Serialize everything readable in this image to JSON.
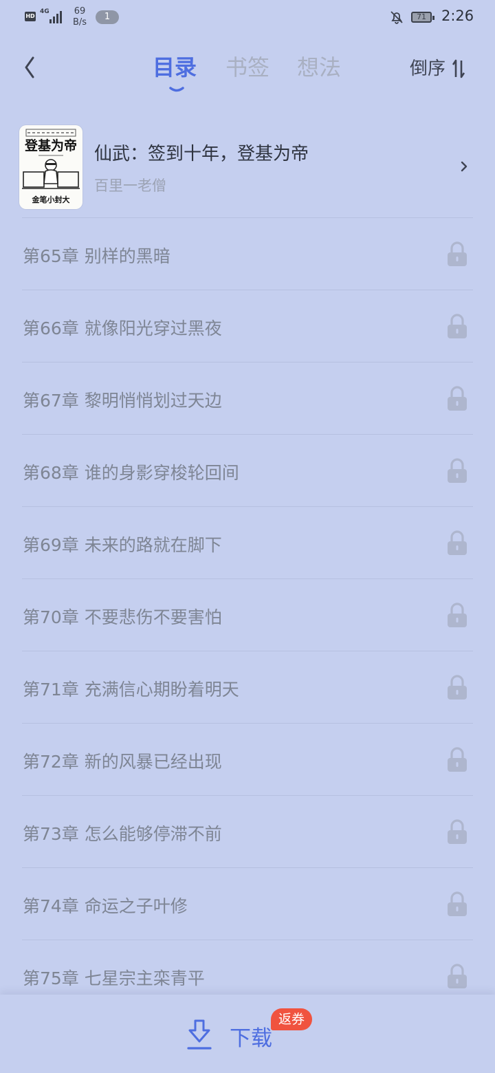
{
  "status_bar": {
    "hd": "HD",
    "network": "4G",
    "speed_value": "69",
    "speed_unit": "B/s",
    "notification_count": "1",
    "battery": "71",
    "time": "2:26"
  },
  "header": {
    "tabs": [
      {
        "label": "目录",
        "active": true
      },
      {
        "label": "书签",
        "active": false
      },
      {
        "label": "想法",
        "active": false
      }
    ],
    "sort_label": "倒序",
    "accent_color": "#4e6ee0"
  },
  "book": {
    "title": "仙武：签到十年，登基为帝",
    "author": "百里一老僧",
    "cover_title": "登基为帝",
    "cover_footer": "金笔小封大"
  },
  "chapters": [
    {
      "title": "第65章 别样的黑暗",
      "locked": true
    },
    {
      "title": "第66章 就像阳光穿过黑夜",
      "locked": true
    },
    {
      "title": "第67章 黎明悄悄划过天边",
      "locked": true
    },
    {
      "title": "第68章 谁的身影穿梭轮回间",
      "locked": true
    },
    {
      "title": "第69章 未来的路就在脚下",
      "locked": true
    },
    {
      "title": "第70章 不要悲伤不要害怕",
      "locked": true
    },
    {
      "title": "第71章 充满信心期盼着明天",
      "locked": true
    },
    {
      "title": "第72章 新的风暴已经出现",
      "locked": true
    },
    {
      "title": "第73章 怎么能够停滞不前",
      "locked": true
    },
    {
      "title": "第74章 命运之子叶修",
      "locked": true
    },
    {
      "title": "第75章 七星宗主栾青平",
      "locked": true
    }
  ],
  "bottom": {
    "download_label": "下载",
    "badge": "返券",
    "badge_color": "#f0533f"
  }
}
